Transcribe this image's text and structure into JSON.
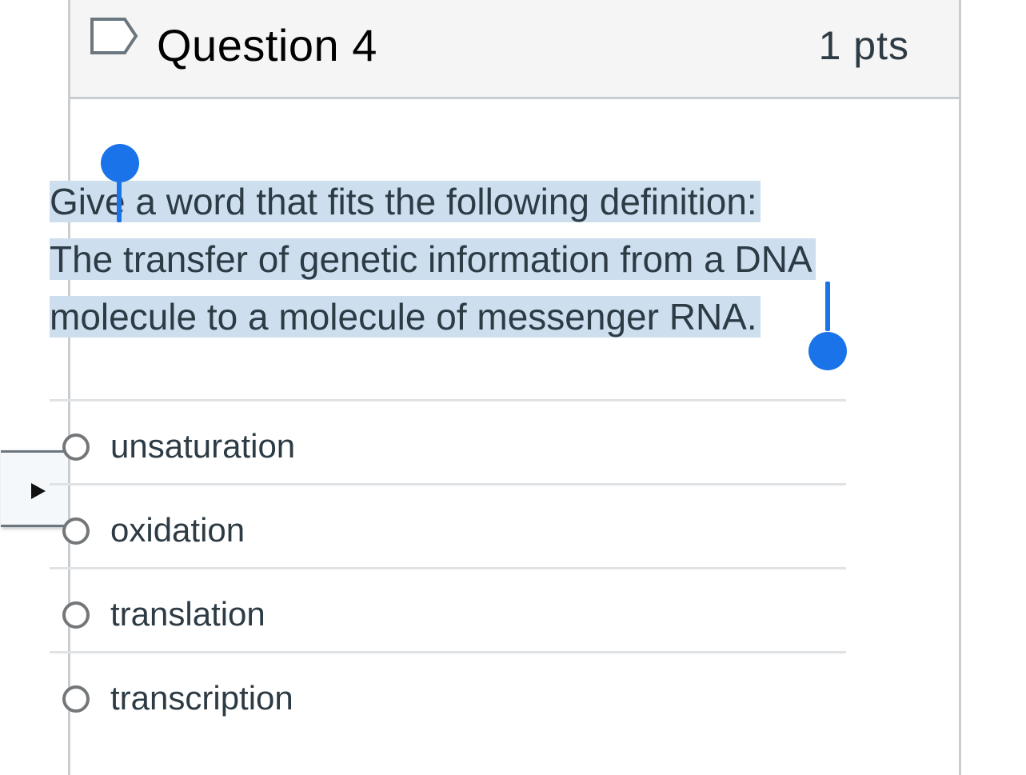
{
  "question": {
    "title": "Question 4",
    "points": "1 pts",
    "flag_icon": "flag-outline-icon",
    "text_lines": [
      "Give a word that fits the following definition:",
      "The transfer of genetic information from a DNA",
      "molecule to a molecule of messenger RNA."
    ],
    "selection_color": "#cddfef",
    "selection_handle_color": "#1a73e8"
  },
  "answers": [
    {
      "label": "unsaturation"
    },
    {
      "label": "oxidation"
    },
    {
      "label": "translation"
    },
    {
      "label": "transcription"
    }
  ],
  "side_toggle": {
    "icon": "play-triangle-icon"
  }
}
